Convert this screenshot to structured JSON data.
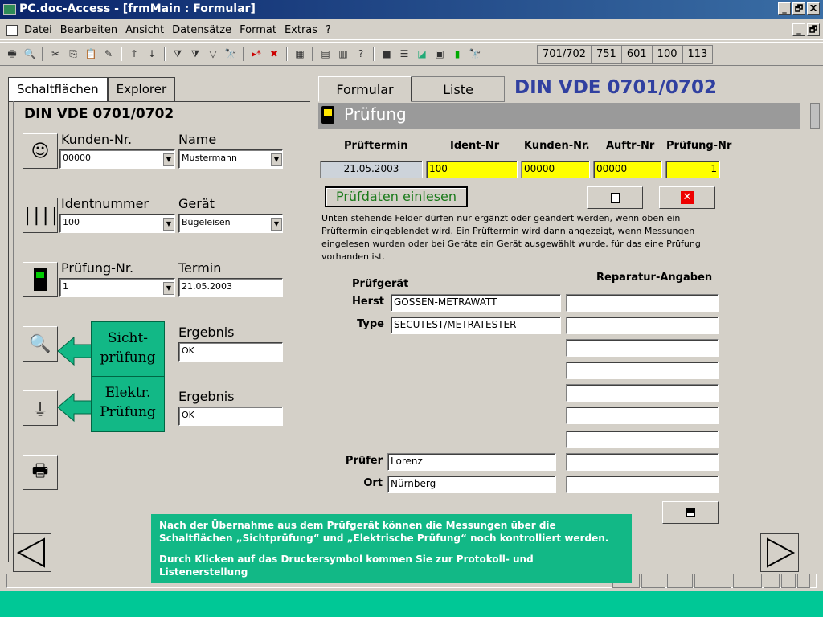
{
  "window": {
    "title": "PC.doc-Access - [frmMain : Formular]",
    "controls": [
      "_",
      "🗗",
      "X"
    ],
    "mdi_controls": [
      "_",
      "🗗"
    ]
  },
  "menu": [
    "Datei",
    "Bearbeiten",
    "Ansicht",
    "Datensätze",
    "Format",
    "Extras",
    "?"
  ],
  "toolbar": {
    "counters": [
      "701/702",
      "751",
      "601",
      "100",
      "113"
    ]
  },
  "left": {
    "tabs": [
      "Schaltflächen",
      "Explorer"
    ],
    "title": "DIN VDE 0701/0702",
    "kunden_label": "Kunden-Nr.",
    "kunden_value": "00000",
    "name_label": "Name",
    "name_value": "Mustermann",
    "ident_label": "Identnummer",
    "ident_value": "100",
    "geraet_label": "Gerät",
    "geraet_value": "Bügeleisen",
    "pruefnr_label": "Prüfung-Nr.",
    "pruefnr_value": "1",
    "termin_label": "Termin",
    "termin_value": "21.05.2003",
    "ergebnis1_label": "Ergebnis",
    "ergebnis1_value": "OK",
    "ergebnis2_label": "Ergebnis",
    "ergebnis2_value": "OK",
    "callout_sicht": [
      "Sicht-",
      "prüfung"
    ],
    "callout_elektr": [
      "Elektr.",
      "Prüfung"
    ]
  },
  "right": {
    "tabs": [
      "Formular",
      "Liste"
    ],
    "heading": "DIN VDE 0701/0702",
    "section": "Prüfung",
    "columns": [
      "Prüftermin",
      "Ident-Nr",
      "Kunden-Nr.",
      "Auftr-Nr",
      "Prüfung-Nr"
    ],
    "values": [
      "21.05.2003",
      "100",
      "00000",
      "00000",
      "1"
    ],
    "read_button": "Prüfdaten einlesen",
    "hint": "Unten stehende Felder dürfen nur ergänzt oder geändert werden, wenn oben ein Prüftermin eingeblendet wird. Ein Prüftermin wird dann angezeigt, wenn Messungen eingelesen wurden oder bei Geräte ein Gerät ausgewählt wurde, für das eine Prüfung vorhanden ist.",
    "pruefgeraet_label": "Prüfgerät",
    "reparatur_label": "Reparatur-Angaben",
    "herst_label": "Herst",
    "herst_value": "GOSSEN-METRAWATT",
    "type_label": "Type",
    "type_value": "SECUTEST/METRATESTER",
    "pruefer_label": "Prüfer",
    "pruefer_value": "Lorenz",
    "ort_label": "Ort",
    "ort_value": "Nürnberg"
  },
  "note": {
    "line1": "Nach der Übernahme aus dem Prüfgerät können die Messungen über die Schaltflächen „Sichtprüfung“ und „Elektrische Prüfung“ noch kontrolliert werden.",
    "line2": "Durch Klicken auf das Druckersymbol kommen Sie zur Protokoll- und Listenerstellung"
  },
  "colors": {
    "accent_green": "#12b886",
    "heading_blue": "#3040a0",
    "title_bar": "#0a246a",
    "highlight_yellow": "#ffff00"
  }
}
